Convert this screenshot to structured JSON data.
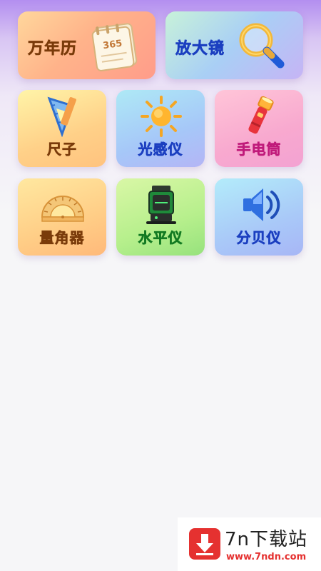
{
  "tools": {
    "calendar": {
      "label": "万年历",
      "icon_text": "365"
    },
    "magnifier": {
      "label": "放大镜"
    },
    "ruler": {
      "label": "尺子"
    },
    "light_sensor": {
      "label": "光感仪"
    },
    "flashlight": {
      "label": "手电筒"
    },
    "protractor": {
      "label": "量角器"
    },
    "spirit_level": {
      "label": "水平仪"
    },
    "decibel_meter": {
      "label": "分贝仪"
    }
  },
  "watermark": {
    "title": "7n下载站",
    "url": "www.7ndn.com"
  },
  "colors": {
    "label_dark_brown": "#7a3b0a",
    "label_blue": "#1b3fc0",
    "label_magenta": "#c01a7a",
    "label_green": "#127a22",
    "watermark_red": "#e53130"
  }
}
